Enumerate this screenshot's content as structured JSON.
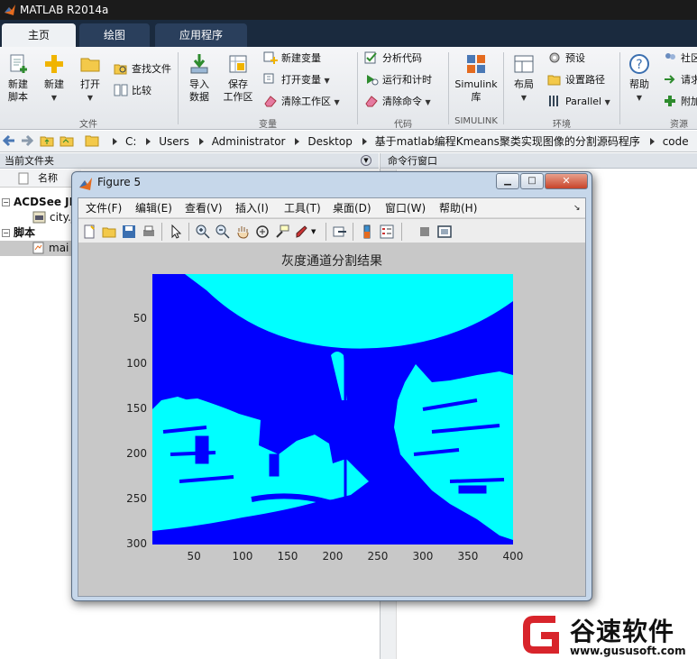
{
  "window": {
    "title": "MATLAB R2014a"
  },
  "tabs": [
    {
      "label": "主页",
      "active": true
    },
    {
      "label": "绘图",
      "active": false
    },
    {
      "label": "应用程序",
      "active": false
    }
  ],
  "ribbon": {
    "file_group": {
      "new_script": [
        "新建",
        "脚本"
      ],
      "new": "新建",
      "open": "打开",
      "find_files": "查找文件",
      "compare": "比较",
      "label": "文件"
    },
    "variable_group": {
      "import": [
        "导入",
        "数据"
      ],
      "save": [
        "保存",
        "工作区"
      ],
      "new_var": "新建变量",
      "open_var": "打开变量",
      "clear_ws": "清除工作区",
      "label": "变量"
    },
    "code_group": {
      "analyze": "分析代码",
      "run_time": "运行和计时",
      "clear_cmd": "清除命令",
      "label": "代码"
    },
    "simulink_group": {
      "simulink": [
        "Simulink",
        "库"
      ],
      "label": "SIMULINK"
    },
    "env_group": {
      "layout": "布局",
      "prefs": "预设",
      "set_path": "设置路径",
      "parallel": "Parallel",
      "label": "环境"
    },
    "resources_group": {
      "help": "帮助",
      "community": "社区",
      "request": "请求",
      "addons": "附加",
      "label": "资源"
    }
  },
  "address": {
    "crumbs": [
      "C:",
      "Users",
      "Administrator",
      "Desktop",
      "基于matlab编程Kmeans聚类实现图像的分割源码程序",
      "code"
    ]
  },
  "current_folder": {
    "header": "当前文件夹",
    "column": "名称",
    "items": [
      {
        "label": "ACDSee JI",
        "level": 0,
        "bold": true,
        "expander": "⊟"
      },
      {
        "label": "city.j",
        "level": 1,
        "bold": false,
        "expander": ""
      },
      {
        "label": "脚本",
        "level": 0,
        "bold": true,
        "expander": "⊟"
      },
      {
        "label": "mai",
        "level": 1,
        "bold": false,
        "expander": ""
      }
    ]
  },
  "command_window": {
    "header": "命令行窗口"
  },
  "figure": {
    "title": "Figure 5",
    "menu": [
      "文件(F)",
      "编辑(E)",
      "查看(V)",
      "插入(I)",
      "工具(T)",
      "桌面(D)",
      "窗口(W)",
      "帮助(H)"
    ]
  },
  "chart_data": {
    "type": "heatmap",
    "title": "灰度通道分割结果",
    "xlabel": "",
    "ylabel": "",
    "xlim": [
      0.5,
      400.5
    ],
    "ylim": [
      300.5,
      0.5
    ],
    "xticks": [
      50,
      100,
      150,
      200,
      250,
      300,
      350,
      400
    ],
    "yticks": [
      50,
      100,
      150,
      200,
      250,
      300
    ],
    "colors": {
      "cluster_1": "#0000ff",
      "cluster_2": "#00ffff"
    }
  },
  "watermark": {
    "brand": "谷速软件",
    "url": "www.gususoft.com"
  },
  "colors": {
    "accent": "#1a2a3e",
    "ribbon": "#e8ebef"
  }
}
